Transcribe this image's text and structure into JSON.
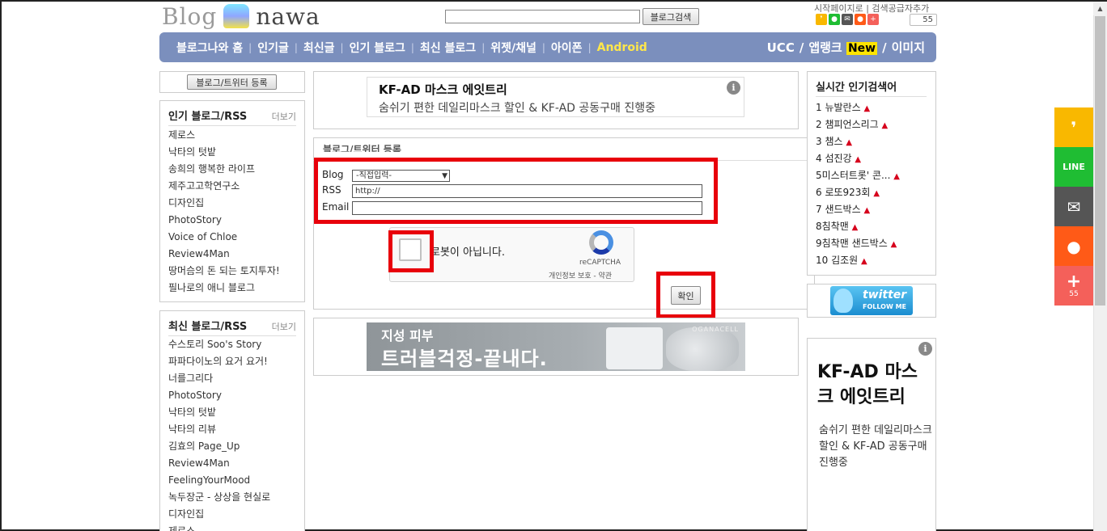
{
  "header": {
    "logo_left": "Blog",
    "logo_right": "nawa",
    "search_button": "블로그검색",
    "top_links": "시작페이지로 | 검색공급자추가",
    "share_count": "55"
  },
  "nav": {
    "items": [
      "블로그나와 홈",
      "인기글",
      "최신글",
      "인기 블로그",
      "최신 블로그",
      "위젯/채널",
      "아이폰",
      "Android"
    ],
    "right": {
      "ucc": "UCC",
      "slash1": "/",
      "app_rank": "앱랭크",
      "new_badge": "New",
      "slash2": "/",
      "image": "이미지"
    }
  },
  "left": {
    "register_button": "블로그/트위터 등록",
    "popular": {
      "title": "인기 블로그/RSS",
      "more": "더보기",
      "items": [
        "제로스",
        "낙타의 텃밭",
        "송희의 행복한 라이프",
        "제주고고학연구소",
        "디자인집",
        "PhotoStory",
        "Voice of Chloe",
        "Review4Man",
        "땅머슴의 돈 되는 토지투자!",
        "필나로의 애니 블로그"
      ]
    },
    "recent": {
      "title": "최신 블로그/RSS",
      "more": "더보기",
      "items": [
        "수스토리 Soo's Story",
        "파파다이노의 요거 요거!",
        "너를그리다",
        "PhotoStory",
        "낙타의 텃밭",
        "낙타의 리뷰",
        "김효의 Page_Up",
        "Review4Man",
        "FeelingYourMood",
        "녹두장군 - 상상을 현실로",
        "디자인집",
        "제로스"
      ]
    }
  },
  "center": {
    "ad_top": {
      "title": "KF-AD 마스크 에잇트리",
      "subtitle": "숨쉬기 편한 데일리마스크 할인 & KF-AD 공동구매 진행중",
      "info": "i"
    },
    "form": {
      "title": "블로그/트위터 등록",
      "blog_label": "Blog",
      "blog_select": "-직접입력-",
      "rss_label": "RSS",
      "rss_value": "http://",
      "email_label": "Email",
      "email_value": "",
      "captcha_text": "로봇이 아닙니다.",
      "captcha_brand": "reCAPTCHA",
      "captcha_links": "개인정보 보호 - 약관",
      "confirm": "확인"
    },
    "ad_banner": {
      "small": "지성 피부",
      "big": "트러블걱정-끝내다.",
      "brand": "OGANACELL"
    }
  },
  "right": {
    "hot": {
      "title": "실시간 인기검색어",
      "items": [
        "1 뉴발란스",
        "2 챔피언스리그",
        "3 챔스",
        "4 섬진강",
        "5미스터트롯' 콘...",
        "6 로또923회",
        "7 샌드박스",
        "8침착맨",
        "9침착맨 샌드박스",
        "10 김조원"
      ]
    },
    "twitter": {
      "label": "twitter",
      "follow": "FOLLOW ME"
    },
    "ad_side": {
      "title": "KF-AD 마스크 에잇트리",
      "body": "숨쉬기 편한 데일리마스크 할인 & KF-AD 공동구매 진행중",
      "info": "i"
    }
  },
  "share_bar": {
    "count": "55"
  },
  "colors": {
    "nav_bg": "#7b8fbd",
    "highlight_red": "#e8000b",
    "kakao": "#f9b800",
    "line": "#1fbd33",
    "mail": "#555555",
    "reddit": "#ff5a17",
    "plus": "#f4605a"
  }
}
